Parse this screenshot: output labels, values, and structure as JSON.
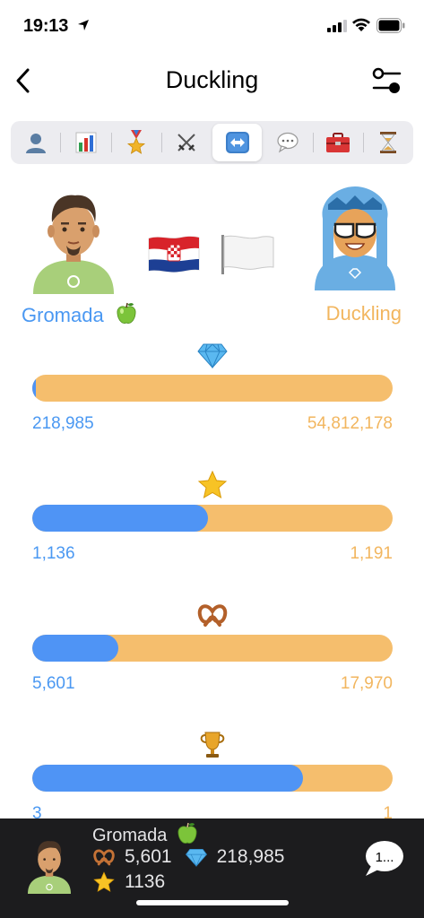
{
  "status_bar": {
    "time": "19:13"
  },
  "nav": {
    "title": "Duckling",
    "back_icon": "chevron-left-icon",
    "filter_icon": "sliders-icon"
  },
  "tabs": [
    {
      "icon": "person-icon",
      "active": false
    },
    {
      "icon": "bar-chart-icon",
      "active": false
    },
    {
      "icon": "medal-icon",
      "active": false
    },
    {
      "icon": "crossed-swords-icon",
      "active": false
    },
    {
      "icon": "left-right-arrow-icon",
      "active": true
    },
    {
      "icon": "speech-bubble-icon",
      "active": false
    },
    {
      "icon": "toolbox-icon",
      "active": false
    },
    {
      "icon": "hourglass-icon",
      "active": false
    }
  ],
  "players": {
    "left": {
      "name": "Gromada",
      "color": "#4a98f2"
    },
    "right": {
      "name": "Duckling",
      "color": "#f2b65f"
    }
  },
  "comparisons": [
    {
      "icon": "diamond-icon",
      "left_value": "218,985",
      "right_value": "54,812,178",
      "left_fraction": 0.004
    },
    {
      "icon": "star-icon",
      "left_value": "1,136",
      "right_value": "1,191",
      "left_fraction": 0.488
    },
    {
      "icon": "pretzel-icon",
      "left_value": "5,601",
      "right_value": "17,970",
      "left_fraction": 0.238
    },
    {
      "icon": "trophy-icon",
      "left_value": "3",
      "right_value": "1",
      "left_fraction": 0.75
    }
  ],
  "bottom": {
    "name": "Gromada",
    "pretzels": "5,601",
    "diamonds": "218,985",
    "stars": "1136",
    "chat_label": "1..."
  }
}
